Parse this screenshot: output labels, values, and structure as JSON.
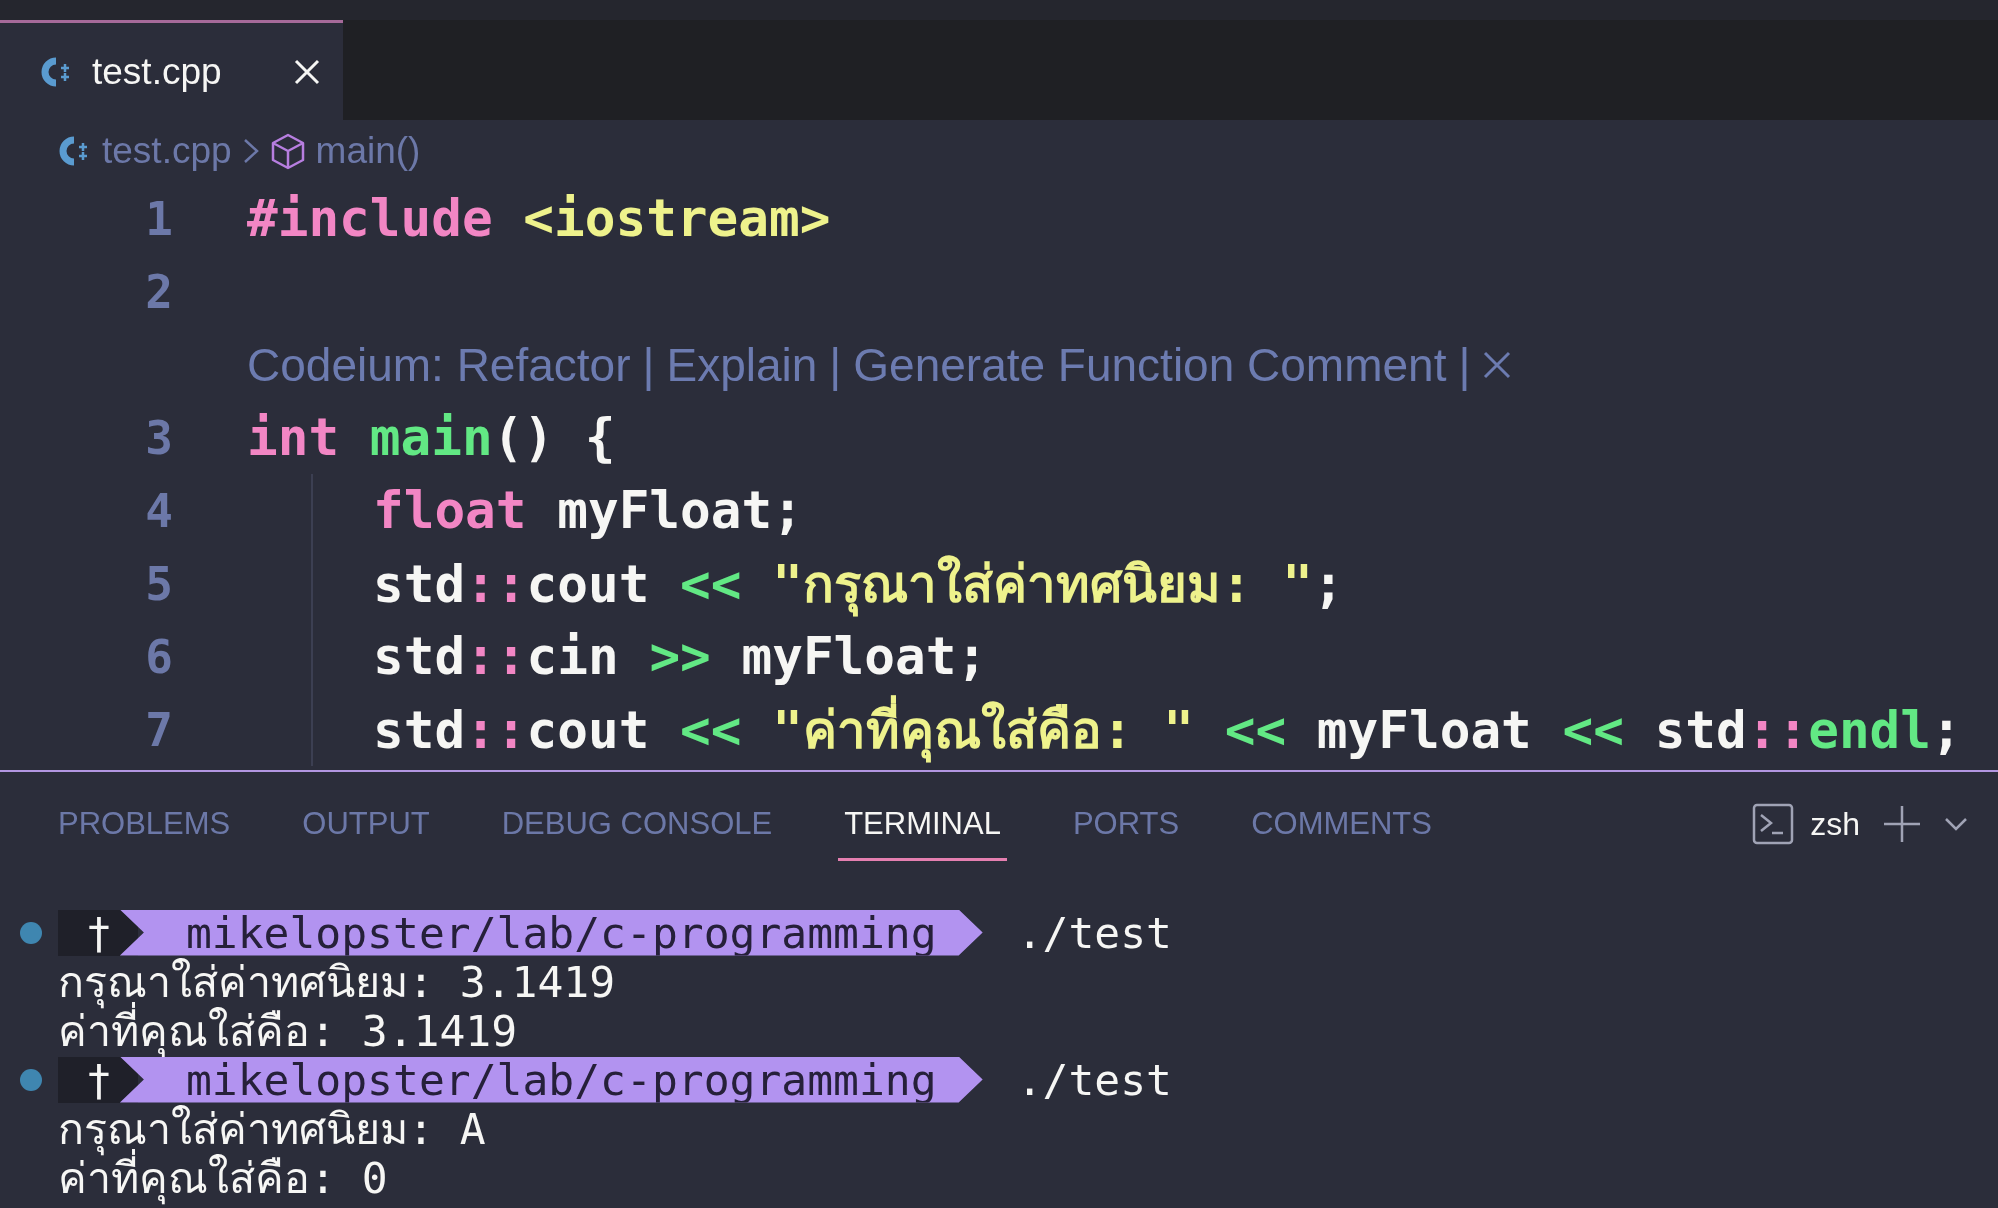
{
  "tabs": [
    {
      "label": "test.cpp",
      "selected": true,
      "kind": "cpp"
    }
  ],
  "breadcrumbs": [
    {
      "label": "test.cpp",
      "kind": "file"
    },
    {
      "label": "main()",
      "kind": "symbol"
    }
  ],
  "editor": {
    "lines": [
      {
        "kind": "code",
        "number": "1",
        "tokens": [
          {
            "text": "#include",
            "kind": "preproc"
          },
          {
            "text": " <iostream>",
            "kind": "string"
          }
        ]
      },
      {
        "kind": "code",
        "number": "2"
      },
      {
        "kind": "codelens",
        "actions": [
          "Codeium: Refactor",
          "Explain",
          "Generate Function Comment"
        ],
        "separator": "|"
      },
      {
        "kind": "code",
        "number": "3",
        "tokens": [
          {
            "text": "int",
            "kind": "keyword"
          },
          {
            "text": " main",
            "kind": "function"
          },
          {
            "text": "() {",
            "kind": "plain"
          }
        ],
        "children": [
          {
            "kind": "code",
            "number": "4",
            "tokens": [
              {
                "text": "float",
                "kind": "keyword"
              },
              {
                "text": " myFloat;",
                "kind": "plain"
              }
            ]
          },
          {
            "kind": "code",
            "number": "5",
            "tokens": [
              {
                "text": "std",
                "kind": "plain"
              },
              {
                "text": "::",
                "kind": "scope"
              },
              {
                "text": "cout ",
                "kind": "plain"
              },
              {
                "text": "<<",
                "kind": "operator"
              },
              {
                "text": " \"กรุณาใส่ค่าทศนิยม: \"",
                "kind": "string"
              },
              {
                "text": ";",
                "kind": "plain"
              }
            ]
          },
          {
            "kind": "code",
            "number": "6",
            "tokens": [
              {
                "text": "std",
                "kind": "plain"
              },
              {
                "text": "::",
                "kind": "scope"
              },
              {
                "text": "cin ",
                "kind": "plain"
              },
              {
                "text": ">>",
                "kind": "operator"
              },
              {
                "text": " myFloat;",
                "kind": "plain"
              }
            ]
          },
          {
            "kind": "code",
            "number": "7",
            "tokens": [
              {
                "text": "std",
                "kind": "plain"
              },
              {
                "text": "::",
                "kind": "scope"
              },
              {
                "text": "cout ",
                "kind": "plain"
              },
              {
                "text": "<<",
                "kind": "operator"
              },
              {
                "text": " \"ค่าที่คุณใส่คือ: \"",
                "kind": "string"
              },
              {
                "text": " <<",
                "kind": "operator"
              },
              {
                "text": " myFloat ",
                "kind": "plain"
              },
              {
                "text": "<<",
                "kind": "operator"
              },
              {
                "text": " std",
                "kind": "plain"
              },
              {
                "text": "::",
                "kind": "scope"
              },
              {
                "text": "endl",
                "kind": "function"
              },
              {
                "text": ";",
                "kind": "plain"
              }
            ]
          }
        ]
      }
    ]
  },
  "panel": {
    "tabs": [
      {
        "label": "PROBLEMS",
        "selected": false
      },
      {
        "label": "OUTPUT",
        "selected": false
      },
      {
        "label": "DEBUG CONSOLE",
        "selected": false
      },
      {
        "label": "TERMINAL",
        "selected": true
      },
      {
        "label": "PORTS",
        "selected": false
      },
      {
        "label": "COMMENTS",
        "selected": false
      }
    ],
    "shell": "zsh",
    "terminal": [
      {
        "kind": "prompt",
        "symbol": "†",
        "path": "mikelopster/lab/c-programming",
        "command": "./test"
      },
      {
        "kind": "output",
        "text": "กรุณาใส่ค่าทศนิยม: 3.1419"
      },
      {
        "kind": "output",
        "text": "ค่าที่คุณใส่คือ: 3.1419"
      },
      {
        "kind": "prompt",
        "symbol": "†",
        "path": "mikelopster/lab/c-programming",
        "command": "./test"
      },
      {
        "kind": "output",
        "text": "กรุณาใส่ค่าทศนิยม: A"
      },
      {
        "kind": "output",
        "text": "ค่าที่คุณใส่คือ: 0"
      }
    ]
  }
}
